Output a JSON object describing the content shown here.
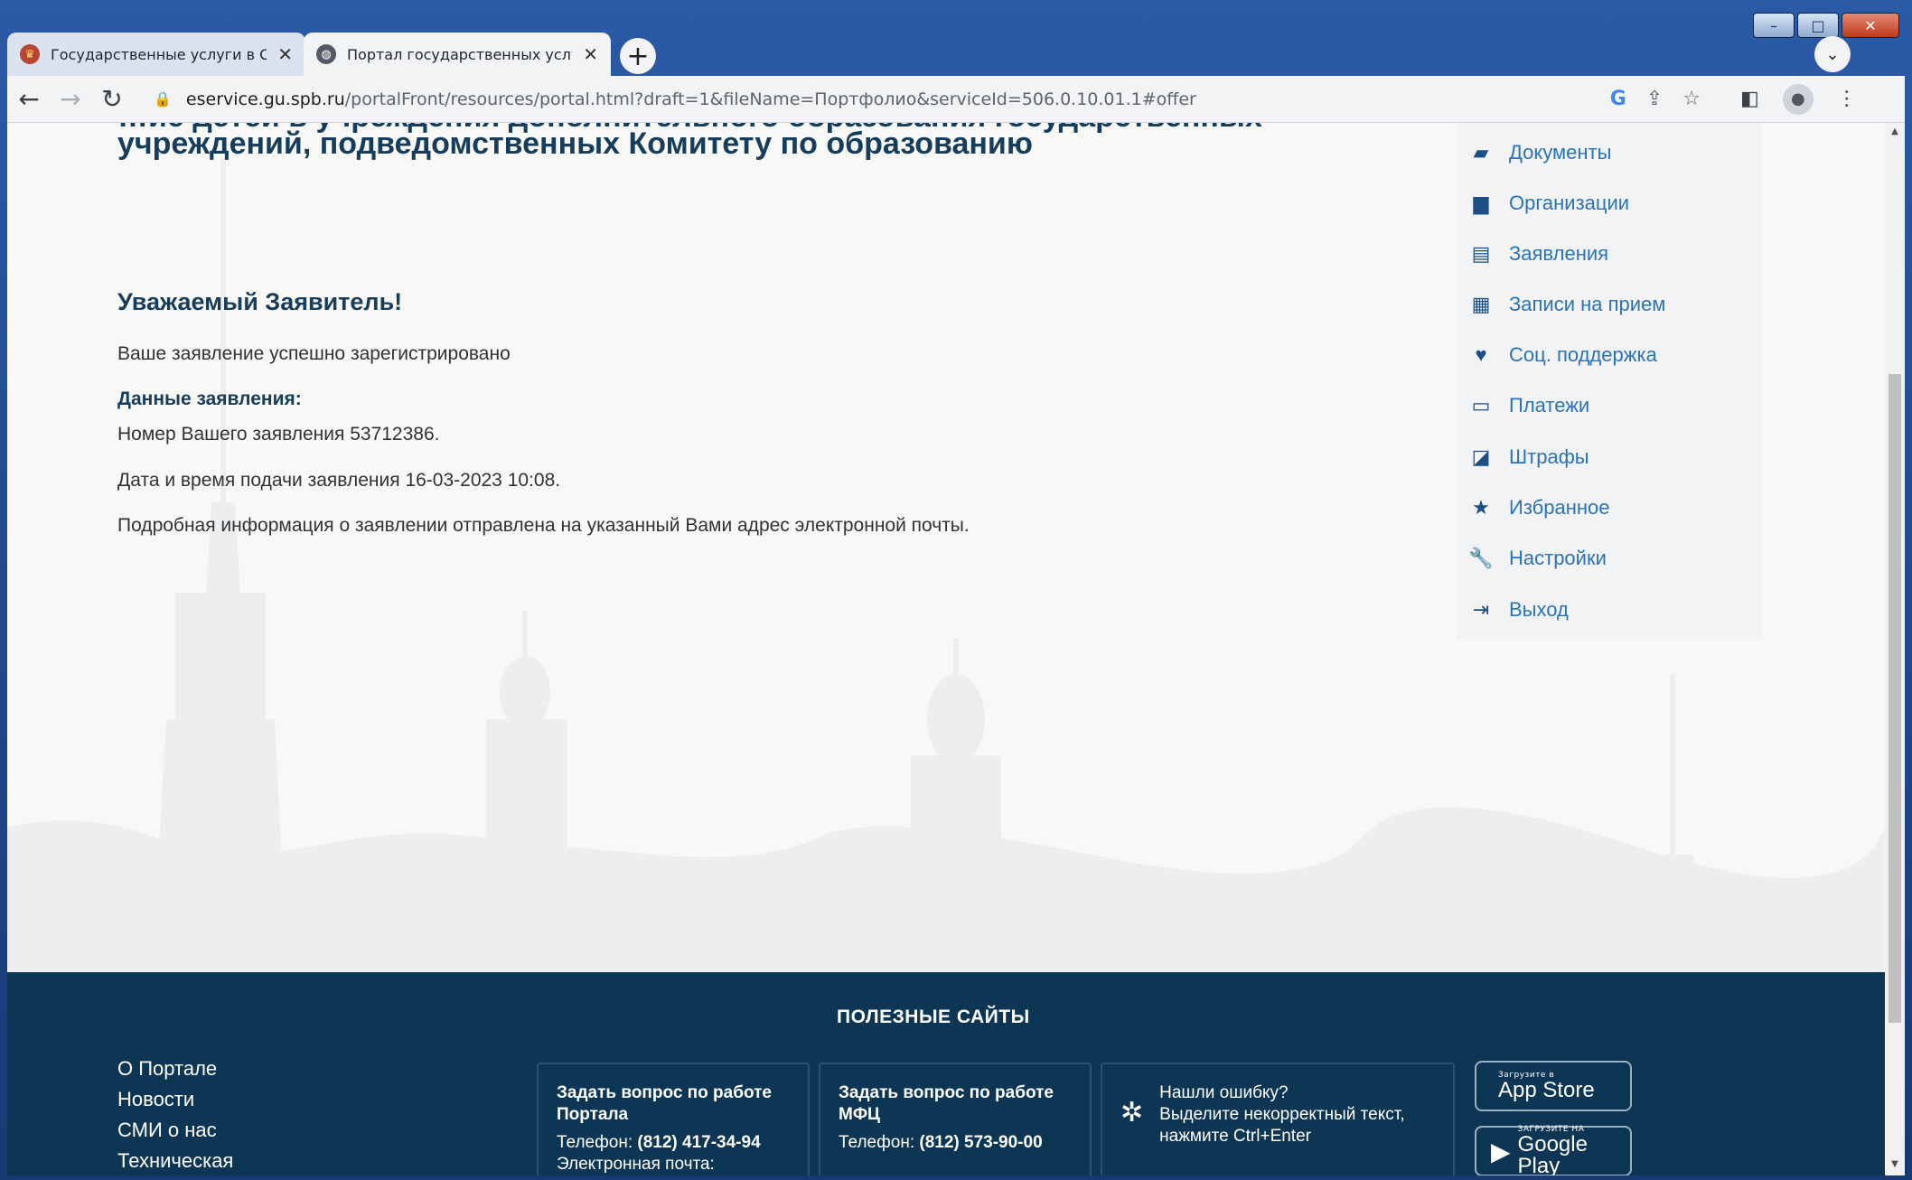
{
  "browser": {
    "tabs": [
      {
        "title": "Государственные услуги в Санкт",
        "close": "✕",
        "favicon": "coat-of-arms-icon"
      },
      {
        "title": "Портал государственных услуг",
        "close": "✕",
        "favicon": "globe-icon"
      }
    ],
    "new_tab": "+",
    "tab_search": "⌄",
    "url_host": "eservice.gu.spb.ru",
    "url_path": "/portalFront/resources/portal.html?draft=1&fileName=Портфолио&serviceId=506.0.10.01.1#offer",
    "window_controls": {
      "minimize": "–",
      "maximize": "□",
      "close": "✕"
    }
  },
  "page": {
    "heading_top": "…ие детей в учреждения дополнительного образования государственных",
    "heading": "учреждений, подведомственных Комитету по образованию",
    "dear": "Уважаемый Заявитель!",
    "success": "Ваше заявление успешно зарегистрировано",
    "data_label": "Данные заявления:",
    "number": "Номер Вашего заявления 53712386.",
    "datetime": "Дата и время подачи заявления 16-03-2023 10:08.",
    "info": "Подробная информация о заявлении отправлена на указанный Вами адрес электронной почты."
  },
  "menu": [
    {
      "label": "Документы",
      "icon": "book-icon"
    },
    {
      "label": "Организации",
      "icon": "building-icon"
    },
    {
      "label": "Заявления",
      "icon": "file-icon"
    },
    {
      "label": "Записи на прием",
      "icon": "calendar-icon"
    },
    {
      "label": "Соц. поддержка",
      "icon": "heart-icon"
    },
    {
      "label": "Платежи",
      "icon": "credit-card-icon"
    },
    {
      "label": "Штрафы",
      "icon": "sticky-note-icon"
    },
    {
      "label": "Избранное",
      "icon": "star-icon"
    },
    {
      "label": "Настройки",
      "icon": "wrench-icon"
    },
    {
      "label": "Выход",
      "icon": "sign-out-icon"
    }
  ],
  "footer": {
    "title": "ПОЛЕЗНЫЕ САЙТЫ",
    "links": [
      "О Портале",
      "Новости",
      "СМИ о нас",
      "Техническая"
    ],
    "box1": {
      "title": "Задать вопрос по работе Портала",
      "phone_label": "Телефон:",
      "phone": "(812) 417-34-94",
      "email_label": "Электронная почта:"
    },
    "box2": {
      "title": "Задать вопрос по работе МФЦ",
      "phone_label": "Телефон:",
      "phone": "(812) 573-90-00"
    },
    "error": {
      "line1": "Нашли ошибку?",
      "line2": "Выделите некорректный текст,",
      "line3": "нажмите Ctrl+Enter"
    },
    "appstore": {
      "small": "Загрузите в",
      "big": "App Store"
    },
    "googleplay": {
      "small": "ЗАГРУЗИТЕ НА",
      "big": "Google Play"
    }
  }
}
